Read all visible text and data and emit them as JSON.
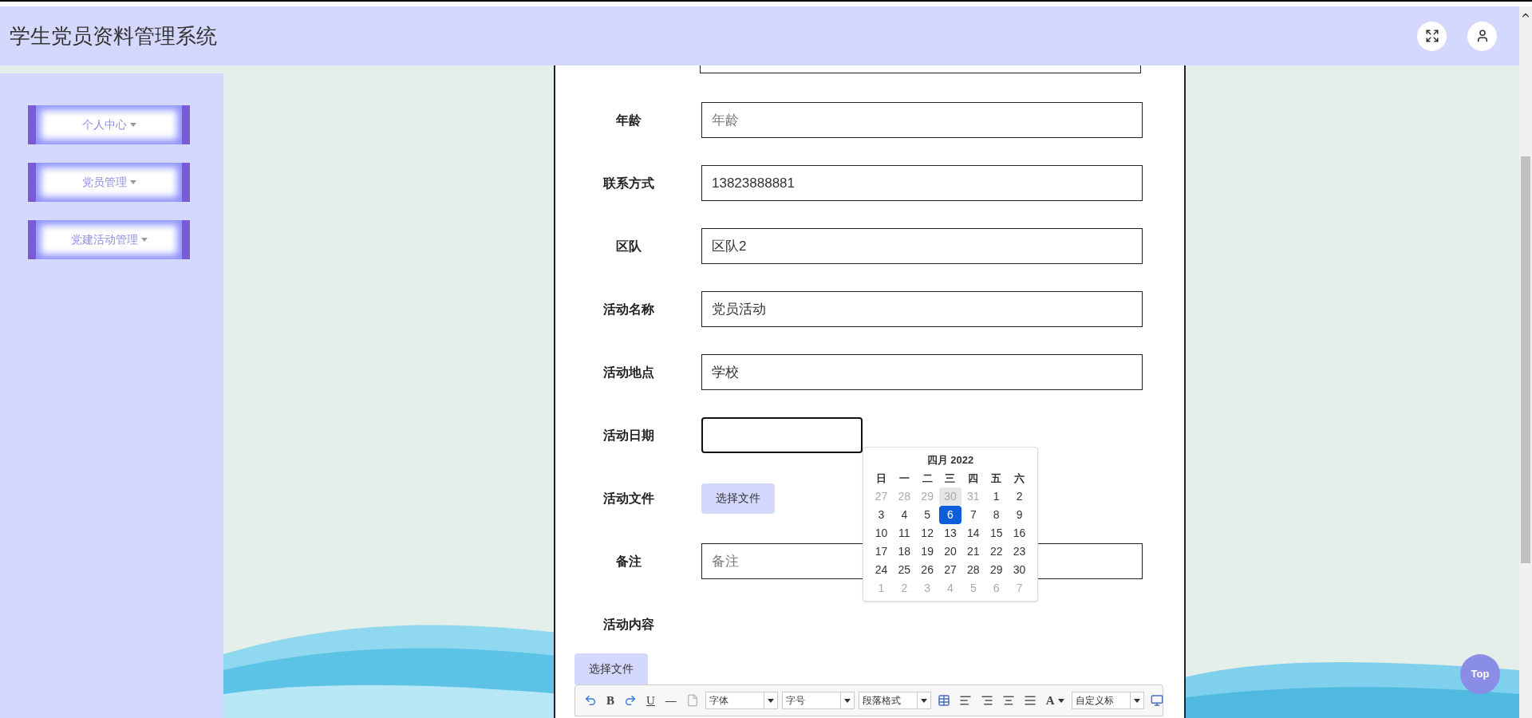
{
  "header": {
    "title": "学生党员资料管理系统"
  },
  "sidebar": {
    "items": [
      {
        "label": "个人中心"
      },
      {
        "label": "党员管理"
      },
      {
        "label": "党建活动管理"
      }
    ]
  },
  "form": {
    "fields": [
      {
        "kind": "input",
        "label": "年龄",
        "placeholder": "年龄"
      },
      {
        "kind": "input",
        "label": "联系方式",
        "value": "13823888881"
      },
      {
        "kind": "input",
        "label": "区队",
        "value": "区队2"
      },
      {
        "kind": "input",
        "label": "活动名称",
        "value": "党员活动"
      },
      {
        "kind": "input",
        "label": "活动地点",
        "value": "学校"
      },
      {
        "kind": "date",
        "label": "活动日期",
        "focused": true
      },
      {
        "kind": "file",
        "label": "活动文件",
        "button": "选择文件"
      },
      {
        "kind": "input",
        "label": "备注",
        "placeholder": "备注"
      },
      {
        "kind": "editor",
        "label": "活动内容",
        "button": "选择文件"
      }
    ]
  },
  "calendar": {
    "title": "四月 2022",
    "weekdays": [
      "日",
      "一",
      "二",
      "三",
      "四",
      "五",
      "六"
    ],
    "weeks": [
      [
        {
          "day": "27",
          "muted": true,
          "selected": false,
          "hovered": false
        },
        {
          "day": "28",
          "muted": true,
          "selected": false,
          "hovered": false
        },
        {
          "day": "29",
          "muted": true,
          "selected": false,
          "hovered": false
        },
        {
          "day": "30",
          "muted": true,
          "selected": false,
          "hovered": true
        },
        {
          "day": "31",
          "muted": true,
          "selected": false,
          "hovered": false
        },
        {
          "day": "1",
          "muted": false,
          "selected": false,
          "hovered": false
        },
        {
          "day": "2",
          "muted": false,
          "selected": false,
          "hovered": false
        }
      ],
      [
        {
          "day": "3",
          "muted": false,
          "selected": false,
          "hovered": false
        },
        {
          "day": "4",
          "muted": false,
          "selected": false,
          "hovered": false
        },
        {
          "day": "5",
          "muted": false,
          "selected": false,
          "hovered": false
        },
        {
          "day": "6",
          "muted": false,
          "selected": true,
          "hovered": false
        },
        {
          "day": "7",
          "muted": false,
          "selected": false,
          "hovered": false
        },
        {
          "day": "8",
          "muted": false,
          "selected": false,
          "hovered": false
        },
        {
          "day": "9",
          "muted": false,
          "selected": false,
          "hovered": false
        }
      ],
      [
        {
          "day": "10",
          "muted": false,
          "selected": false,
          "hovered": false
        },
        {
          "day": "11",
          "muted": false,
          "selected": false,
          "hovered": false
        },
        {
          "day": "12",
          "muted": false,
          "selected": false,
          "hovered": false
        },
        {
          "day": "13",
          "muted": false,
          "selected": false,
          "hovered": false
        },
        {
          "day": "14",
          "muted": false,
          "selected": false,
          "hovered": false
        },
        {
          "day": "15",
          "muted": false,
          "selected": false,
          "hovered": false
        },
        {
          "day": "16",
          "muted": false,
          "selected": false,
          "hovered": false
        }
      ],
      [
        {
          "day": "17",
          "muted": false,
          "selected": false,
          "hovered": false
        },
        {
          "day": "18",
          "muted": false,
          "selected": false,
          "hovered": false
        },
        {
          "day": "19",
          "muted": false,
          "selected": false,
          "hovered": false
        },
        {
          "day": "20",
          "muted": false,
          "selected": false,
          "hovered": false
        },
        {
          "day": "21",
          "muted": false,
          "selected": false,
          "hovered": false
        },
        {
          "day": "22",
          "muted": false,
          "selected": false,
          "hovered": false
        },
        {
          "day": "23",
          "muted": false,
          "selected": false,
          "hovered": false
        }
      ],
      [
        {
          "day": "24",
          "muted": false,
          "selected": false,
          "hovered": false
        },
        {
          "day": "25",
          "muted": false,
          "selected": false,
          "hovered": false
        },
        {
          "day": "26",
          "muted": false,
          "selected": false,
          "hovered": false
        },
        {
          "day": "27",
          "muted": false,
          "selected": false,
          "hovered": false
        },
        {
          "day": "28",
          "muted": false,
          "selected": false,
          "hovered": false
        },
        {
          "day": "29",
          "muted": false,
          "selected": false,
          "hovered": false
        },
        {
          "day": "30",
          "muted": false,
          "selected": false,
          "hovered": false
        }
      ],
      [
        {
          "day": "1",
          "muted": true,
          "selected": false,
          "hovered": false
        },
        {
          "day": "2",
          "muted": true,
          "selected": false,
          "hovered": false
        },
        {
          "day": "3",
          "muted": true,
          "selected": false,
          "hovered": false
        },
        {
          "day": "4",
          "muted": true,
          "selected": false,
          "hovered": false
        },
        {
          "day": "5",
          "muted": true,
          "selected": false,
          "hovered": false
        },
        {
          "day": "6",
          "muted": true,
          "selected": false,
          "hovered": false
        },
        {
          "day": "7",
          "muted": true,
          "selected": false,
          "hovered": false
        }
      ]
    ]
  },
  "toolbar": {
    "items": [
      {
        "kind": "undo"
      },
      {
        "kind": "bold",
        "text": "B"
      },
      {
        "kind": "redo"
      },
      {
        "kind": "underline",
        "text": "U"
      },
      {
        "kind": "rule",
        "text": "—"
      },
      {
        "kind": "page"
      },
      {
        "kind": "select",
        "text": "字体"
      },
      {
        "kind": "select",
        "text": "字号"
      },
      {
        "kind": "select",
        "text": "段落格式"
      },
      {
        "kind": "table"
      },
      {
        "kind": "align-left"
      },
      {
        "kind": "align-right"
      },
      {
        "kind": "align-center"
      },
      {
        "kind": "justify"
      },
      {
        "kind": "color",
        "text": "A"
      },
      {
        "kind": "select",
        "text": "自定义标"
      },
      {
        "kind": "preview"
      }
    ]
  },
  "top_button": {
    "text": "Top"
  }
}
